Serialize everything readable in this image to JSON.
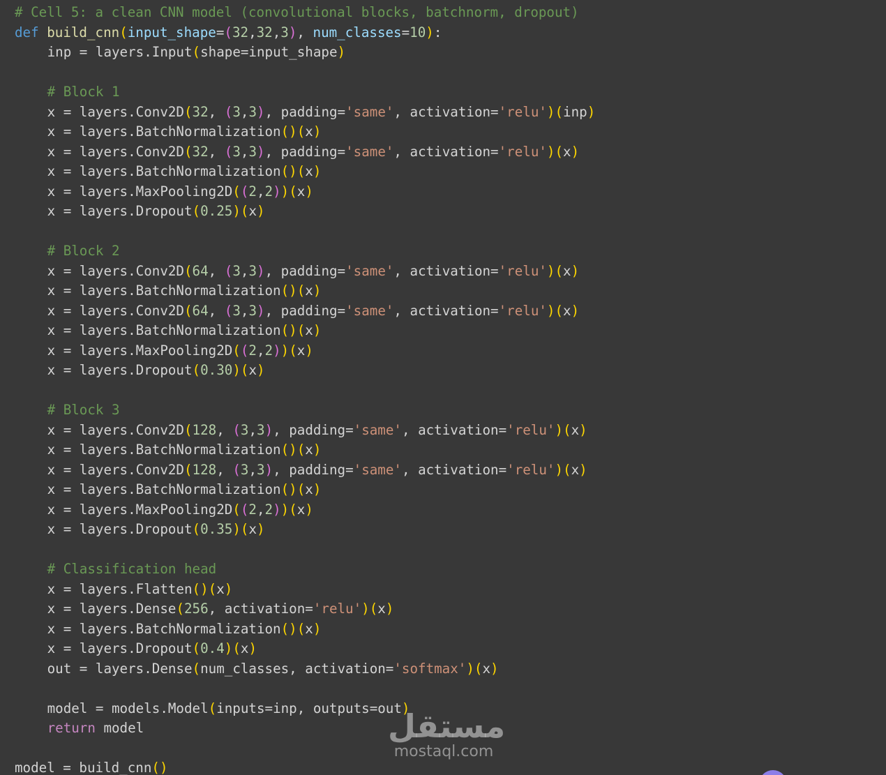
{
  "code_lines": [
    [
      {
        "t": "# Cell 5: a clean CNN model (convolutional blocks, batchnorm, dropout)",
        "c": "cm"
      }
    ],
    [
      {
        "t": "def ",
        "c": "kw"
      },
      {
        "t": "build_cnn",
        "c": "fn"
      },
      {
        "t": "(",
        "c": "b1"
      },
      {
        "t": "input_shape",
        "c": "pm"
      },
      {
        "t": "=",
        "c": "op"
      },
      {
        "t": "(",
        "c": "b2"
      },
      {
        "t": "32",
        "c": "nu"
      },
      {
        "t": ",",
        "c": "op"
      },
      {
        "t": "32",
        "c": "nu"
      },
      {
        "t": ",",
        "c": "op"
      },
      {
        "t": "3",
        "c": "nu"
      },
      {
        "t": ")",
        "c": "b2"
      },
      {
        "t": ", ",
        "c": "op"
      },
      {
        "t": "num_classes",
        "c": "pm"
      },
      {
        "t": "=",
        "c": "op"
      },
      {
        "t": "10",
        "c": "nu"
      },
      {
        "t": ")",
        "c": "b1"
      },
      {
        "t": ":",
        "c": "op"
      }
    ],
    [
      {
        "t": "inp = layers.",
        "c": "op",
        "i": 1
      },
      {
        "t": "Input",
        "c": "op"
      },
      {
        "t": "(",
        "c": "b1"
      },
      {
        "t": "shape=input_shape",
        "c": "op"
      },
      {
        "t": ")",
        "c": "b1"
      }
    ],
    [],
    [
      {
        "t": "# Block 1",
        "c": "cm",
        "i": 1
      }
    ],
    [
      {
        "t": "x = layers.",
        "c": "op",
        "i": 1
      },
      {
        "t": "Conv2D",
        "c": "op"
      },
      {
        "t": "(",
        "c": "b1"
      },
      {
        "t": "32",
        "c": "nu"
      },
      {
        "t": ", ",
        "c": "op"
      },
      {
        "t": "(",
        "c": "b2"
      },
      {
        "t": "3",
        "c": "nu"
      },
      {
        "t": ",",
        "c": "op"
      },
      {
        "t": "3",
        "c": "nu"
      },
      {
        "t": ")",
        "c": "b2"
      },
      {
        "t": ", padding=",
        "c": "op"
      },
      {
        "t": "'same'",
        "c": "st"
      },
      {
        "t": ", activation=",
        "c": "op"
      },
      {
        "t": "'relu'",
        "c": "st"
      },
      {
        "t": ")",
        "c": "b1"
      },
      {
        "t": "(",
        "c": "b1"
      },
      {
        "t": "inp",
        "c": "op"
      },
      {
        "t": ")",
        "c": "b1"
      }
    ],
    [
      {
        "t": "x = layers.",
        "c": "op",
        "i": 1
      },
      {
        "t": "BatchNormalization",
        "c": "op"
      },
      {
        "t": "()",
        "c": "b1"
      },
      {
        "t": "(",
        "c": "b1"
      },
      {
        "t": "x",
        "c": "op"
      },
      {
        "t": ")",
        "c": "b1"
      }
    ],
    [
      {
        "t": "x = layers.",
        "c": "op",
        "i": 1
      },
      {
        "t": "Conv2D",
        "c": "op"
      },
      {
        "t": "(",
        "c": "b1"
      },
      {
        "t": "32",
        "c": "nu"
      },
      {
        "t": ", ",
        "c": "op"
      },
      {
        "t": "(",
        "c": "b2"
      },
      {
        "t": "3",
        "c": "nu"
      },
      {
        "t": ",",
        "c": "op"
      },
      {
        "t": "3",
        "c": "nu"
      },
      {
        "t": ")",
        "c": "b2"
      },
      {
        "t": ", padding=",
        "c": "op"
      },
      {
        "t": "'same'",
        "c": "st"
      },
      {
        "t": ", activation=",
        "c": "op"
      },
      {
        "t": "'relu'",
        "c": "st"
      },
      {
        "t": ")",
        "c": "b1"
      },
      {
        "t": "(",
        "c": "b1"
      },
      {
        "t": "x",
        "c": "op"
      },
      {
        "t": ")",
        "c": "b1"
      }
    ],
    [
      {
        "t": "x = layers.",
        "c": "op",
        "i": 1
      },
      {
        "t": "BatchNormalization",
        "c": "op"
      },
      {
        "t": "()",
        "c": "b1"
      },
      {
        "t": "(",
        "c": "b1"
      },
      {
        "t": "x",
        "c": "op"
      },
      {
        "t": ")",
        "c": "b1"
      }
    ],
    [
      {
        "t": "x = layers.",
        "c": "op",
        "i": 1
      },
      {
        "t": "MaxPooling2D",
        "c": "op"
      },
      {
        "t": "(",
        "c": "b1"
      },
      {
        "t": "(",
        "c": "b2"
      },
      {
        "t": "2",
        "c": "nu"
      },
      {
        "t": ",",
        "c": "op"
      },
      {
        "t": "2",
        "c": "nu"
      },
      {
        "t": ")",
        "c": "b2"
      },
      {
        "t": ")",
        "c": "b1"
      },
      {
        "t": "(",
        "c": "b1"
      },
      {
        "t": "x",
        "c": "op"
      },
      {
        "t": ")",
        "c": "b1"
      }
    ],
    [
      {
        "t": "x = layers.",
        "c": "op",
        "i": 1
      },
      {
        "t": "Dropout",
        "c": "op"
      },
      {
        "t": "(",
        "c": "b1"
      },
      {
        "t": "0.25",
        "c": "nu"
      },
      {
        "t": ")",
        "c": "b1"
      },
      {
        "t": "(",
        "c": "b1"
      },
      {
        "t": "x",
        "c": "op"
      },
      {
        "t": ")",
        "c": "b1"
      }
    ],
    [],
    [
      {
        "t": "# Block 2",
        "c": "cm",
        "i": 1
      }
    ],
    [
      {
        "t": "x = layers.",
        "c": "op",
        "i": 1
      },
      {
        "t": "Conv2D",
        "c": "op"
      },
      {
        "t": "(",
        "c": "b1"
      },
      {
        "t": "64",
        "c": "nu"
      },
      {
        "t": ", ",
        "c": "op"
      },
      {
        "t": "(",
        "c": "b2"
      },
      {
        "t": "3",
        "c": "nu"
      },
      {
        "t": ",",
        "c": "op"
      },
      {
        "t": "3",
        "c": "nu"
      },
      {
        "t": ")",
        "c": "b2"
      },
      {
        "t": ", padding=",
        "c": "op"
      },
      {
        "t": "'same'",
        "c": "st"
      },
      {
        "t": ", activation=",
        "c": "op"
      },
      {
        "t": "'relu'",
        "c": "st"
      },
      {
        "t": ")",
        "c": "b1"
      },
      {
        "t": "(",
        "c": "b1"
      },
      {
        "t": "x",
        "c": "op"
      },
      {
        "t": ")",
        "c": "b1"
      }
    ],
    [
      {
        "t": "x = layers.",
        "c": "op",
        "i": 1
      },
      {
        "t": "BatchNormalization",
        "c": "op"
      },
      {
        "t": "()",
        "c": "b1"
      },
      {
        "t": "(",
        "c": "b1"
      },
      {
        "t": "x",
        "c": "op"
      },
      {
        "t": ")",
        "c": "b1"
      }
    ],
    [
      {
        "t": "x = layers.",
        "c": "op",
        "i": 1
      },
      {
        "t": "Conv2D",
        "c": "op"
      },
      {
        "t": "(",
        "c": "b1"
      },
      {
        "t": "64",
        "c": "nu"
      },
      {
        "t": ", ",
        "c": "op"
      },
      {
        "t": "(",
        "c": "b2"
      },
      {
        "t": "3",
        "c": "nu"
      },
      {
        "t": ",",
        "c": "op"
      },
      {
        "t": "3",
        "c": "nu"
      },
      {
        "t": ")",
        "c": "b2"
      },
      {
        "t": ", padding=",
        "c": "op"
      },
      {
        "t": "'same'",
        "c": "st"
      },
      {
        "t": ", activation=",
        "c": "op"
      },
      {
        "t": "'relu'",
        "c": "st"
      },
      {
        "t": ")",
        "c": "b1"
      },
      {
        "t": "(",
        "c": "b1"
      },
      {
        "t": "x",
        "c": "op"
      },
      {
        "t": ")",
        "c": "b1"
      }
    ],
    [
      {
        "t": "x = layers.",
        "c": "op",
        "i": 1
      },
      {
        "t": "BatchNormalization",
        "c": "op"
      },
      {
        "t": "()",
        "c": "b1"
      },
      {
        "t": "(",
        "c": "b1"
      },
      {
        "t": "x",
        "c": "op"
      },
      {
        "t": ")",
        "c": "b1"
      }
    ],
    [
      {
        "t": "x = layers.",
        "c": "op",
        "i": 1
      },
      {
        "t": "MaxPooling2D",
        "c": "op"
      },
      {
        "t": "(",
        "c": "b1"
      },
      {
        "t": "(",
        "c": "b2"
      },
      {
        "t": "2",
        "c": "nu"
      },
      {
        "t": ",",
        "c": "op"
      },
      {
        "t": "2",
        "c": "nu"
      },
      {
        "t": ")",
        "c": "b2"
      },
      {
        "t": ")",
        "c": "b1"
      },
      {
        "t": "(",
        "c": "b1"
      },
      {
        "t": "x",
        "c": "op"
      },
      {
        "t": ")",
        "c": "b1"
      }
    ],
    [
      {
        "t": "x = layers.",
        "c": "op",
        "i": 1
      },
      {
        "t": "Dropout",
        "c": "op"
      },
      {
        "t": "(",
        "c": "b1"
      },
      {
        "t": "0.30",
        "c": "nu"
      },
      {
        "t": ")",
        "c": "b1"
      },
      {
        "t": "(",
        "c": "b1"
      },
      {
        "t": "x",
        "c": "op"
      },
      {
        "t": ")",
        "c": "b1"
      }
    ],
    [],
    [
      {
        "t": "# Block 3",
        "c": "cm",
        "i": 1
      }
    ],
    [
      {
        "t": "x = layers.",
        "c": "op",
        "i": 1
      },
      {
        "t": "Conv2D",
        "c": "op"
      },
      {
        "t": "(",
        "c": "b1"
      },
      {
        "t": "128",
        "c": "nu"
      },
      {
        "t": ", ",
        "c": "op"
      },
      {
        "t": "(",
        "c": "b2"
      },
      {
        "t": "3",
        "c": "nu"
      },
      {
        "t": ",",
        "c": "op"
      },
      {
        "t": "3",
        "c": "nu"
      },
      {
        "t": ")",
        "c": "b2"
      },
      {
        "t": ", padding=",
        "c": "op"
      },
      {
        "t": "'same'",
        "c": "st"
      },
      {
        "t": ", activation=",
        "c": "op"
      },
      {
        "t": "'relu'",
        "c": "st"
      },
      {
        "t": ")",
        "c": "b1"
      },
      {
        "t": "(",
        "c": "b1"
      },
      {
        "t": "x",
        "c": "op"
      },
      {
        "t": ")",
        "c": "b1"
      }
    ],
    [
      {
        "t": "x = layers.",
        "c": "op",
        "i": 1
      },
      {
        "t": "BatchNormalization",
        "c": "op"
      },
      {
        "t": "()",
        "c": "b1"
      },
      {
        "t": "(",
        "c": "b1"
      },
      {
        "t": "x",
        "c": "op"
      },
      {
        "t": ")",
        "c": "b1"
      }
    ],
    [
      {
        "t": "x = layers.",
        "c": "op",
        "i": 1
      },
      {
        "t": "Conv2D",
        "c": "op"
      },
      {
        "t": "(",
        "c": "b1"
      },
      {
        "t": "128",
        "c": "nu"
      },
      {
        "t": ", ",
        "c": "op"
      },
      {
        "t": "(",
        "c": "b2"
      },
      {
        "t": "3",
        "c": "nu"
      },
      {
        "t": ",",
        "c": "op"
      },
      {
        "t": "3",
        "c": "nu"
      },
      {
        "t": ")",
        "c": "b2"
      },
      {
        "t": ", padding=",
        "c": "op"
      },
      {
        "t": "'same'",
        "c": "st"
      },
      {
        "t": ", activation=",
        "c": "op"
      },
      {
        "t": "'relu'",
        "c": "st"
      },
      {
        "t": ")",
        "c": "b1"
      },
      {
        "t": "(",
        "c": "b1"
      },
      {
        "t": "x",
        "c": "op"
      },
      {
        "t": ")",
        "c": "b1"
      }
    ],
    [
      {
        "t": "x = layers.",
        "c": "op",
        "i": 1
      },
      {
        "t": "BatchNormalization",
        "c": "op"
      },
      {
        "t": "()",
        "c": "b1"
      },
      {
        "t": "(",
        "c": "b1"
      },
      {
        "t": "x",
        "c": "op"
      },
      {
        "t": ")",
        "c": "b1"
      }
    ],
    [
      {
        "t": "x = layers.",
        "c": "op",
        "i": 1
      },
      {
        "t": "MaxPooling2D",
        "c": "op"
      },
      {
        "t": "(",
        "c": "b1"
      },
      {
        "t": "(",
        "c": "b2"
      },
      {
        "t": "2",
        "c": "nu"
      },
      {
        "t": ",",
        "c": "op"
      },
      {
        "t": "2",
        "c": "nu"
      },
      {
        "t": ")",
        "c": "b2"
      },
      {
        "t": ")",
        "c": "b1"
      },
      {
        "t": "(",
        "c": "b1"
      },
      {
        "t": "x",
        "c": "op"
      },
      {
        "t": ")",
        "c": "b1"
      }
    ],
    [
      {
        "t": "x = layers.",
        "c": "op",
        "i": 1
      },
      {
        "t": "Dropout",
        "c": "op"
      },
      {
        "t": "(",
        "c": "b1"
      },
      {
        "t": "0.35",
        "c": "nu"
      },
      {
        "t": ")",
        "c": "b1"
      },
      {
        "t": "(",
        "c": "b1"
      },
      {
        "t": "x",
        "c": "op"
      },
      {
        "t": ")",
        "c": "b1"
      }
    ],
    [],
    [
      {
        "t": "# Classification head",
        "c": "cm",
        "i": 1
      }
    ],
    [
      {
        "t": "x = layers.",
        "c": "op",
        "i": 1
      },
      {
        "t": "Flatten",
        "c": "op"
      },
      {
        "t": "()",
        "c": "b1"
      },
      {
        "t": "(",
        "c": "b1"
      },
      {
        "t": "x",
        "c": "op"
      },
      {
        "t": ")",
        "c": "b1"
      }
    ],
    [
      {
        "t": "x = layers.",
        "c": "op",
        "i": 1
      },
      {
        "t": "Dense",
        "c": "op"
      },
      {
        "t": "(",
        "c": "b1"
      },
      {
        "t": "256",
        "c": "nu"
      },
      {
        "t": ", activation=",
        "c": "op"
      },
      {
        "t": "'relu'",
        "c": "st"
      },
      {
        "t": ")",
        "c": "b1"
      },
      {
        "t": "(",
        "c": "b1"
      },
      {
        "t": "x",
        "c": "op"
      },
      {
        "t": ")",
        "c": "b1"
      }
    ],
    [
      {
        "t": "x = layers.",
        "c": "op",
        "i": 1
      },
      {
        "t": "BatchNormalization",
        "c": "op"
      },
      {
        "t": "()",
        "c": "b1"
      },
      {
        "t": "(",
        "c": "b1"
      },
      {
        "t": "x",
        "c": "op"
      },
      {
        "t": ")",
        "c": "b1"
      }
    ],
    [
      {
        "t": "x = layers.",
        "c": "op",
        "i": 1
      },
      {
        "t": "Dropout",
        "c": "op"
      },
      {
        "t": "(",
        "c": "b1"
      },
      {
        "t": "0.4",
        "c": "nu"
      },
      {
        "t": ")",
        "c": "b1"
      },
      {
        "t": "(",
        "c": "b1"
      },
      {
        "t": "x",
        "c": "op"
      },
      {
        "t": ")",
        "c": "b1"
      }
    ],
    [
      {
        "t": "out = layers.",
        "c": "op",
        "i": 1
      },
      {
        "t": "Dense",
        "c": "op"
      },
      {
        "t": "(",
        "c": "b1"
      },
      {
        "t": "num_classes, activation=",
        "c": "op"
      },
      {
        "t": "'softmax'",
        "c": "st"
      },
      {
        "t": ")",
        "c": "b1"
      },
      {
        "t": "(",
        "c": "b1"
      },
      {
        "t": "x",
        "c": "op"
      },
      {
        "t": ")",
        "c": "b1"
      }
    ],
    [],
    [
      {
        "t": "model = models.",
        "c": "op",
        "i": 1
      },
      {
        "t": "Model",
        "c": "op"
      },
      {
        "t": "(",
        "c": "b1"
      },
      {
        "t": "inputs=inp, outputs=out",
        "c": "op"
      },
      {
        "t": ")",
        "c": "b1"
      }
    ],
    [
      {
        "t": "return",
        "c": "rkw",
        "i": 1
      },
      {
        "t": " model",
        "c": "op"
      }
    ],
    [],
    [
      {
        "t": "model = build_cnn",
        "c": "op"
      },
      {
        "t": "()",
        "c": "b1"
      }
    ]
  ],
  "watermark": {
    "arabic": "مستقل",
    "latin": "mostaql.com"
  },
  "colors": {
    "background": "#383838",
    "comment": "#6a9955",
    "keyword": "#569cd6",
    "function": "#dcdcaa",
    "parameter": "#9cdcfe",
    "number": "#b5cea8",
    "string": "#ce9178",
    "bracket_level1": "#ffd700",
    "bracket_level2": "#da70d6"
  }
}
